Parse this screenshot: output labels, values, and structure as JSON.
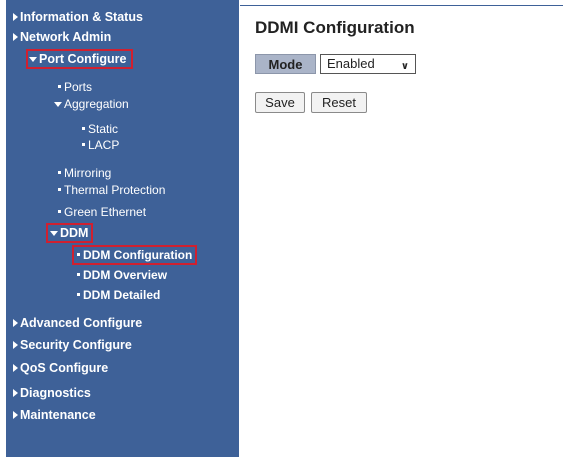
{
  "sidebar": {
    "items": [
      {
        "label": "Information & Status"
      },
      {
        "label": "Network Admin"
      },
      {
        "label": "Port Configure"
      },
      {
        "label": "Ports"
      },
      {
        "label": "Aggregation"
      },
      {
        "label": "Static"
      },
      {
        "label": "LACP"
      },
      {
        "label": "Mirroring"
      },
      {
        "label": "Thermal Protection"
      },
      {
        "label": "Green Ethernet"
      },
      {
        "label": "DDM"
      },
      {
        "label": "DDM Configuration"
      },
      {
        "label": "DDM Overview"
      },
      {
        "label": "DDM Detailed"
      },
      {
        "label": "Advanced Configure"
      },
      {
        "label": "Security Configure"
      },
      {
        "label": "QoS Configure"
      },
      {
        "label": "Diagnostics"
      },
      {
        "label": "Maintenance"
      }
    ]
  },
  "main": {
    "title": "DDMI Configuration",
    "mode_label": "Mode",
    "mode_value": "Enabled",
    "save_label": "Save",
    "reset_label": "Reset"
  },
  "colors": {
    "sidebar_bg": "#3e6198",
    "highlight": "#d02030"
  }
}
